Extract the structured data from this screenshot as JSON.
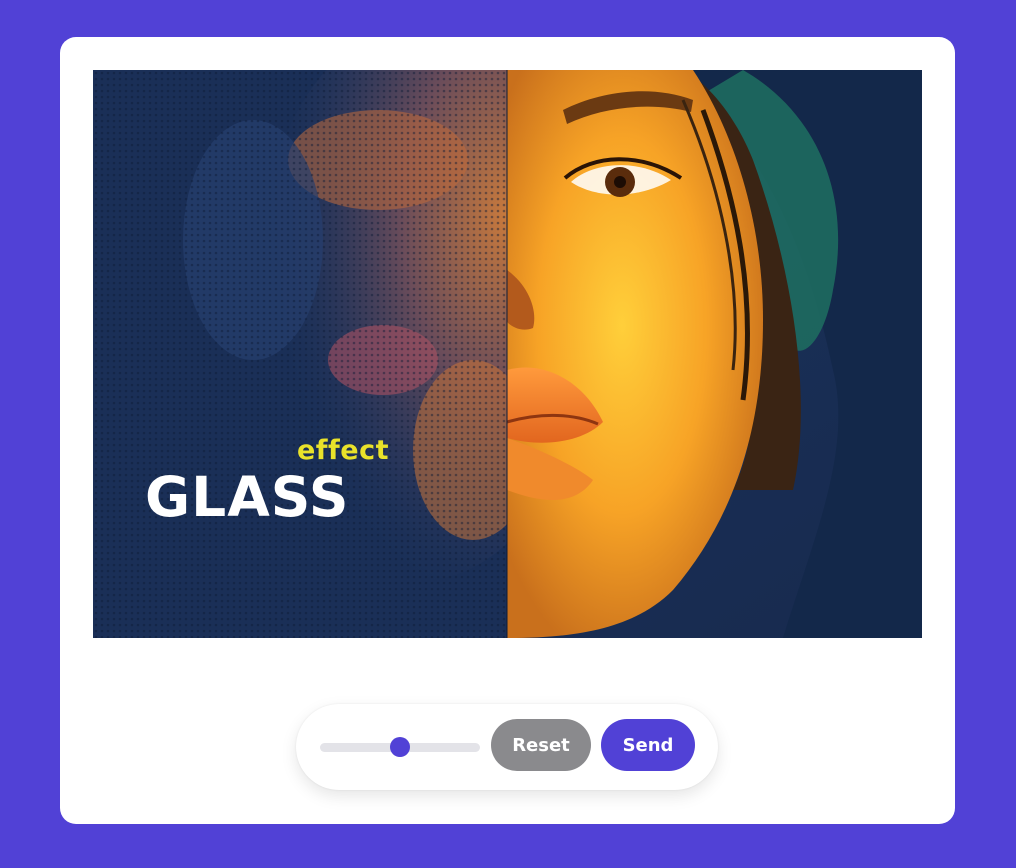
{
  "artwork": {
    "effect_text": "effect",
    "glass_text": "GLASS"
  },
  "controls": {
    "slider_value": 0.5,
    "reset_label": "Reset",
    "send_label": "Send"
  },
  "colors": {
    "background": "#5141d6",
    "card": "#ffffff",
    "accent": "#5141d6",
    "reset_button": "#8a8a8d",
    "effect_text": "#e9e22a",
    "glass_text": "#ffffff"
  }
}
